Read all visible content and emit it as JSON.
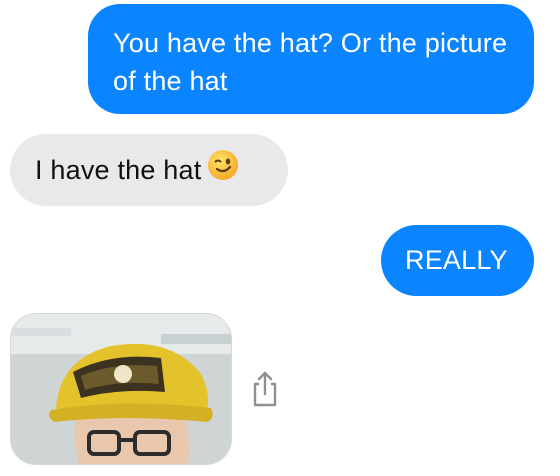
{
  "messages": [
    {
      "direction": "sent",
      "text": "You have the hat? Or the picture of the hat"
    },
    {
      "direction": "received",
      "text": "I have the hat",
      "emoji": "winking-face-icon"
    },
    {
      "direction": "sent",
      "text": "REALLY"
    },
    {
      "direction": "received",
      "attachment": "photo of a person wearing a yellow cap",
      "action_icon": "share-icon"
    }
  ],
  "colors": {
    "sent_bubble": "#0a84ff",
    "received_bubble": "#e9e9eb",
    "hat_yellow": "#e5c32a",
    "share_icon": "#8e8e93"
  }
}
